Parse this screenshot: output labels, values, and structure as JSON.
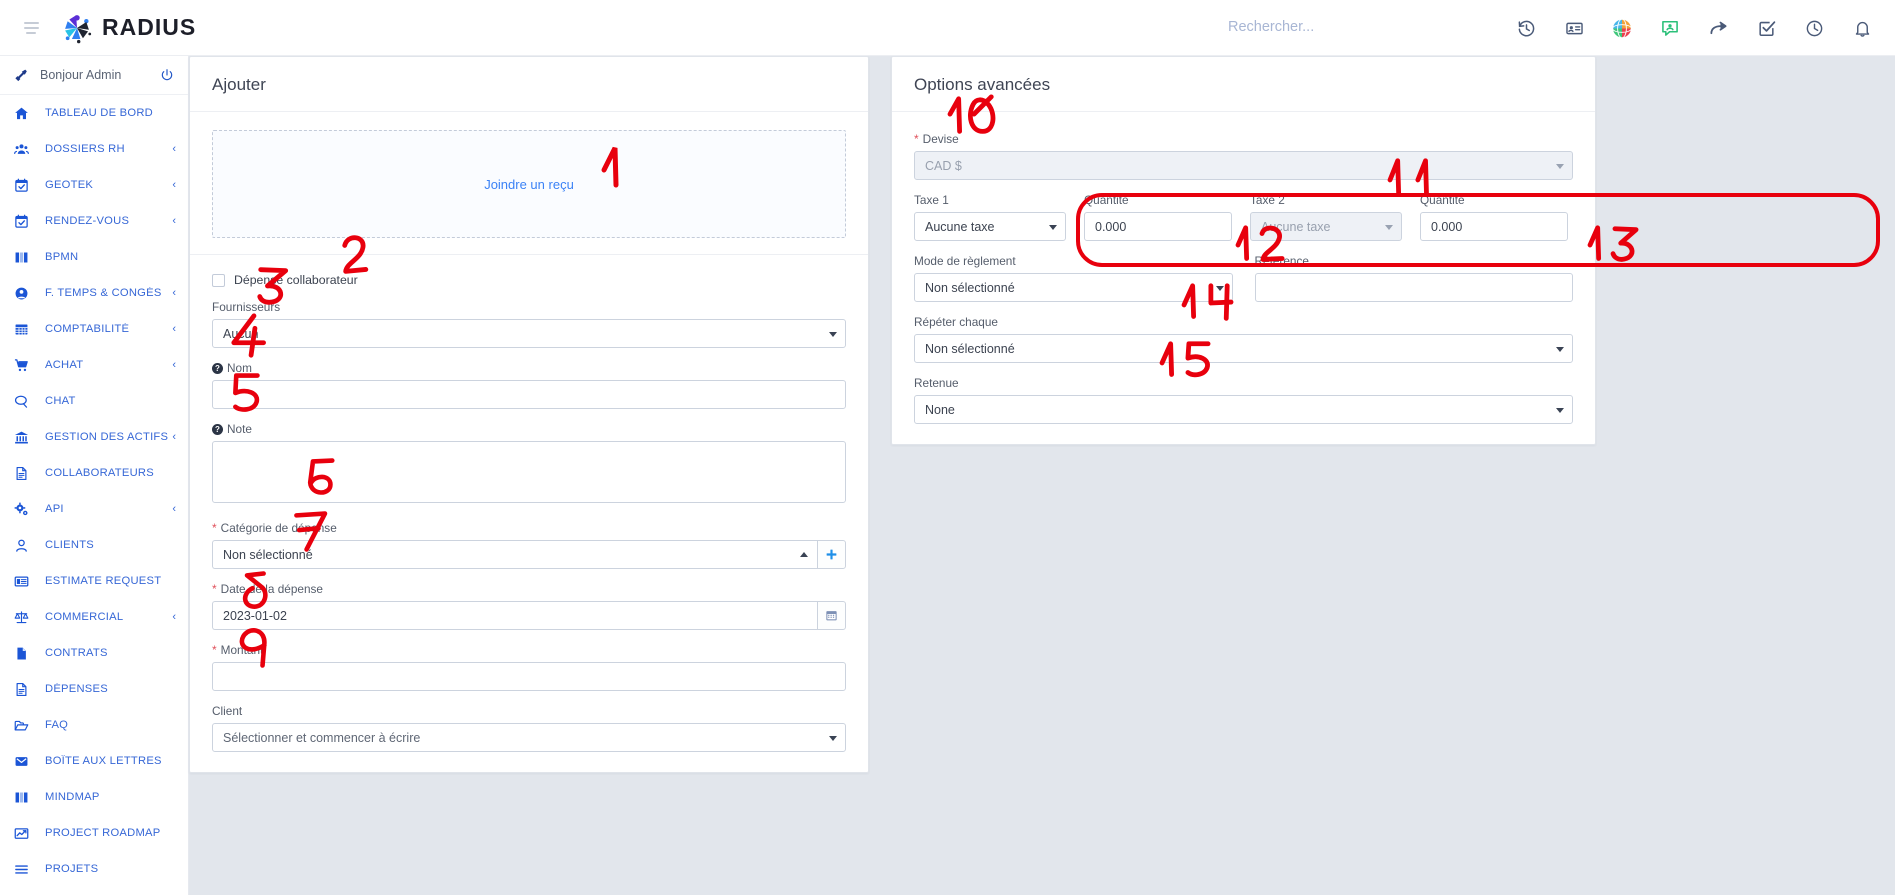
{
  "brand": {
    "name": "RADIUS"
  },
  "search": {
    "placeholder": "Rechercher...",
    "value": ""
  },
  "topbar": {
    "icons": [
      {
        "name": "history-icon"
      },
      {
        "name": "id-card-icon"
      },
      {
        "name": "globe-colorful-icon"
      },
      {
        "name": "contact-chat-icon"
      },
      {
        "name": "share-arrow-icon"
      },
      {
        "name": "checkbox-task-icon"
      },
      {
        "name": "clock-icon"
      },
      {
        "name": "bell-icon"
      }
    ]
  },
  "sidebar": {
    "greeting": "Bonjour Admin",
    "items": [
      {
        "label": "TABLEAU DE BORD",
        "icon": "home-icon",
        "caret": ""
      },
      {
        "label": "DOSSIERS RH",
        "icon": "users-icon",
        "caret": "‹"
      },
      {
        "label": "GEOTEK",
        "icon": "calendar-check-icon",
        "caret": "‹"
      },
      {
        "label": "RENDEZ-VOUS",
        "icon": "calendar-check-icon",
        "caret": "‹"
      },
      {
        "label": "BPMN",
        "icon": "book-icon",
        "caret": ""
      },
      {
        "label": "F. TEMPS & CONGÉS",
        "icon": "user-circle-icon",
        "caret": "‹"
      },
      {
        "label": "COMPTABILITÉ",
        "icon": "grid-table-icon",
        "caret": "‹"
      },
      {
        "label": "ACHAT",
        "icon": "cart-icon",
        "caret": "‹"
      },
      {
        "label": "CHAT",
        "icon": "chat-bubble-icon",
        "caret": ""
      },
      {
        "label": "GESTION DES ACTIFS",
        "icon": "bank-icon",
        "caret": "‹"
      },
      {
        "label": "COLLABORATEURS",
        "icon": "document-lines-icon",
        "caret": ""
      },
      {
        "label": "API",
        "icon": "gears-icon",
        "caret": "‹"
      },
      {
        "label": "CLIENTS",
        "icon": "user-outline-icon",
        "caret": ""
      },
      {
        "label": "ESTIMATE REQUEST",
        "icon": "list-card-icon",
        "caret": ""
      },
      {
        "label": "COMMERCIAL",
        "icon": "scales-icon",
        "caret": "‹"
      },
      {
        "label": "CONTRATS",
        "icon": "file-filled-icon",
        "caret": ""
      },
      {
        "label": "DÉPENSES",
        "icon": "document-lines-icon",
        "caret": ""
      },
      {
        "label": "FAQ",
        "icon": "folder-open-icon",
        "caret": ""
      },
      {
        "label": "BOÎTE AUX LETTRES",
        "icon": "envelope-icon",
        "caret": ""
      },
      {
        "label": "MINDMAP",
        "icon": "book-icon",
        "caret": ""
      },
      {
        "label": "PROJECT ROADMAP",
        "icon": "chart-line-icon",
        "caret": ""
      },
      {
        "label": "PROJETS",
        "icon": "bars-icon",
        "caret": ""
      }
    ]
  },
  "left_panel": {
    "title": "Ajouter",
    "dropzone_label": "Joindre un reçu",
    "checkbox_label": "Dépense collaborateur",
    "checkbox_checked": false,
    "fields": {
      "fournisseurs": {
        "label": "Fournisseurs",
        "value": "Aucun"
      },
      "nom": {
        "label": "Nom",
        "value": ""
      },
      "note": {
        "label": "Note",
        "value": ""
      },
      "categorie": {
        "label": "Catégorie de dépense",
        "value": "Non sélectionné",
        "required": true,
        "add_button": "+"
      },
      "date": {
        "label": "Date de la dépense",
        "value": "2023-01-02",
        "required": true
      },
      "montant": {
        "label": "Montant",
        "value": "",
        "required": true
      },
      "client": {
        "label": "Client",
        "placeholder": "Sélectionner et commencer à écrire",
        "value": ""
      }
    }
  },
  "right_panel": {
    "title": "Options avancées",
    "fields": {
      "devise": {
        "label": "Devise",
        "value": "CAD $",
        "required": true,
        "disabled": true
      },
      "taxe1": {
        "label": "Taxe 1",
        "value": "Aucune taxe"
      },
      "quantite1": {
        "label": "Quantité",
        "value": "0.000"
      },
      "taxe2": {
        "label": "Taxe 2",
        "value": "Aucune taxe",
        "disabled": true
      },
      "quantite2": {
        "label": "Quantité",
        "value": "0.000"
      },
      "mode_reglement": {
        "label": "Mode de règlement",
        "value": "Non sélectionné"
      },
      "reference": {
        "label": "Référence",
        "value": ""
      },
      "repeter": {
        "label": "Répéter chaque",
        "value": "Non sélectionné"
      },
      "retenue": {
        "label": "Retenue",
        "value": "None"
      }
    }
  },
  "annotations": {
    "color": "#e8000d",
    "marks": [
      {
        "id": "1",
        "text": "1"
      },
      {
        "id": "2",
        "text": "2"
      },
      {
        "id": "3",
        "text": "3"
      },
      {
        "id": "4",
        "text": "4"
      },
      {
        "id": "5",
        "text": "5"
      },
      {
        "id": "6",
        "text": "6"
      },
      {
        "id": "7",
        "text": "7"
      },
      {
        "id": "8",
        "text": "8"
      },
      {
        "id": "9",
        "text": "9"
      },
      {
        "id": "10",
        "text": "10"
      },
      {
        "id": "11",
        "text": "11"
      },
      {
        "id": "12",
        "text": "12"
      },
      {
        "id": "13",
        "text": "13"
      },
      {
        "id": "14",
        "text": "14"
      },
      {
        "id": "15",
        "text": "15"
      }
    ]
  },
  "colors": {
    "page_bg": "#e2e6ec",
    "sidebar_link": "#3667d6",
    "accent_blue": "#1b55d6",
    "annotation_red": "#e8000d",
    "required_star": "#e0515b"
  }
}
